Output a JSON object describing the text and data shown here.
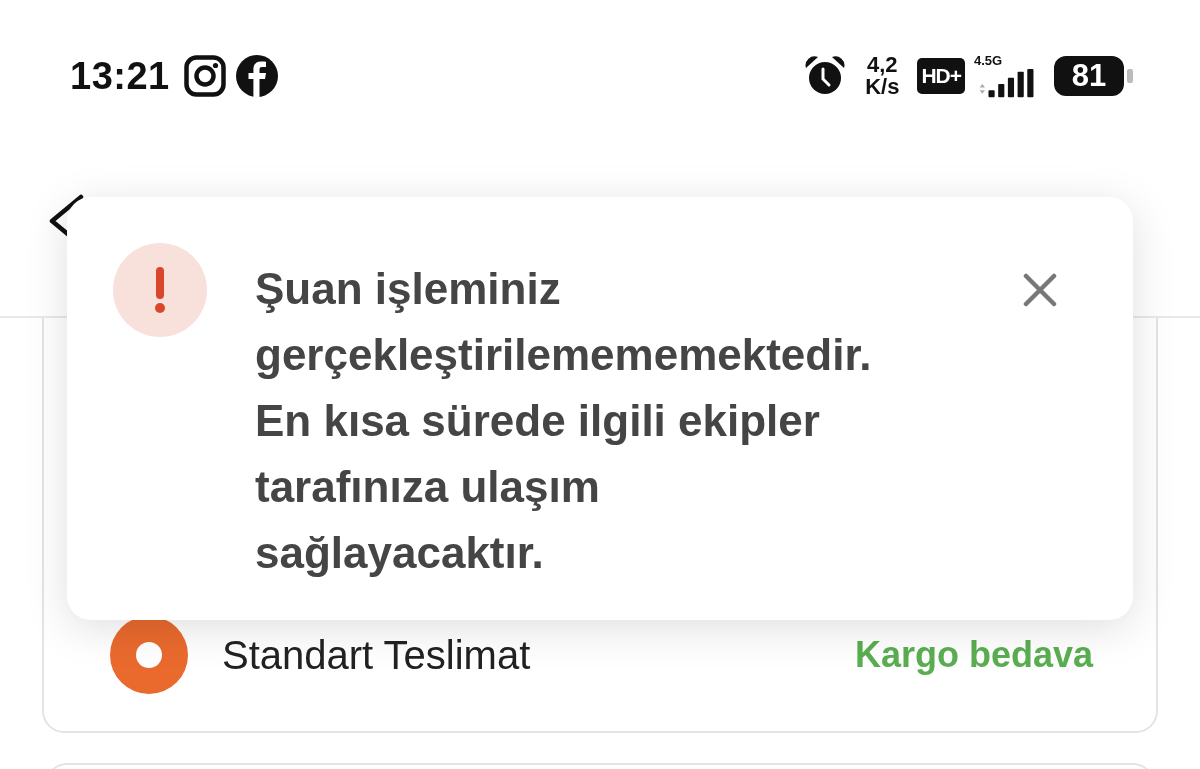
{
  "status_bar": {
    "time": "13:21",
    "network_speed": {
      "value": "4,2",
      "unit": "K/s"
    },
    "hd_badge": "HD+",
    "network_type": "4.5G",
    "battery": "81"
  },
  "delivery_options": [
    {
      "label": "Standart Teslimat",
      "price": "Kargo bedava",
      "selected": true
    }
  ],
  "alert": {
    "message": "Şuan işleminiz gerçekleştirilemememektedir. En kısa sürede ilgili ekipler tarafınıza ulaşım sağlayacaktır."
  }
}
